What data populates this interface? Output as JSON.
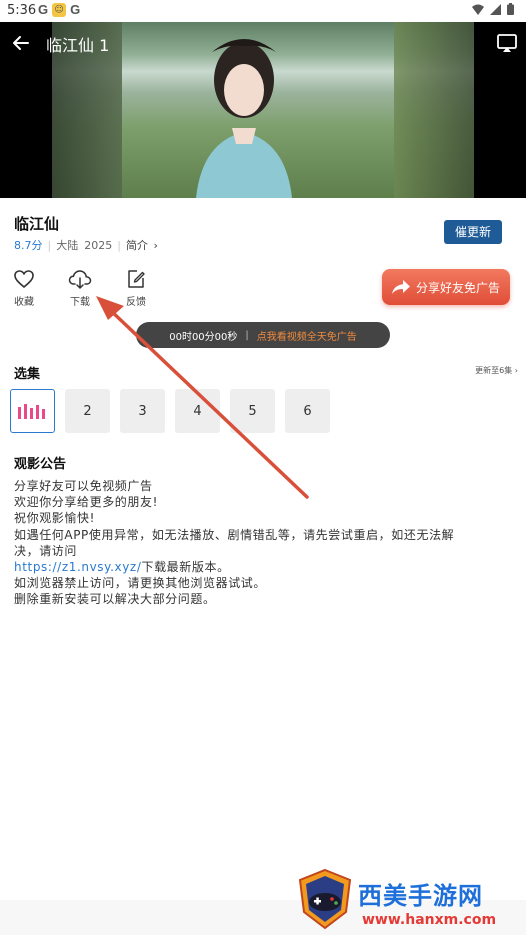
{
  "status_bar": {
    "time": "5:36",
    "left_icons": [
      "google-icon",
      "app-notification-icon",
      "google-icon"
    ],
    "right_icons": [
      "wifi-icon",
      "cellular-icon",
      "battery-icon"
    ]
  },
  "player": {
    "title": "临江仙 1"
  },
  "show": {
    "title": "临江仙",
    "rating": "8.7分",
    "region": "大陆",
    "year": "2025",
    "intro_label": "简介",
    "urge_update_label": "催更新"
  },
  "actions": {
    "favorite_label": "收藏",
    "download_label": "下载",
    "feedback_label": "反馈",
    "share_label": "分享好友免广告"
  },
  "timer": {
    "time": "00时00分00秒",
    "separator": "|",
    "ad_text": "点我看视频全天免广告"
  },
  "episodes": {
    "heading": "选集",
    "update_status": "更新至6集",
    "items": [
      "2",
      "3",
      "4",
      "5",
      "6"
    ]
  },
  "notice": {
    "heading": "观影公告",
    "lines": [
      "分享好友可以免视频广告",
      "欢迎你分享给更多的朋友!",
      "祝你观影愉快!",
      "如遇任何APP使用异常，如无法播放、剧情错乱等，请先尝试重启，如还无法解",
      "决，请访问"
    ],
    "url": "https://z1.nvsy.xyz/",
    "url_suffix": "下载最新版本。",
    "lines_after": [
      "如浏览器禁止访问，请更换其他浏览器试试。",
      "删除重新安装可以解决大部分问题。"
    ]
  },
  "watermark": {
    "name": "西美手游网",
    "url": "www.hanxm.com"
  },
  "colors": {
    "accent_blue": "#2a7bd0",
    "button_navy": "#1f5b96",
    "share_red": "#e04d37",
    "ad_orange": "#f08a3e",
    "annotation_red": "#d9503a"
  }
}
